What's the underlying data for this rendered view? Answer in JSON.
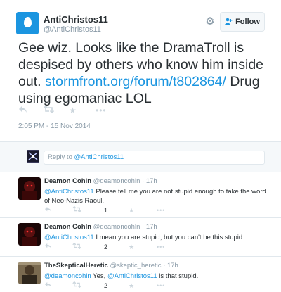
{
  "tweet": {
    "author_name": "AntiChristos11",
    "author_handle": "@AntiChristos11",
    "follow_label": "Follow",
    "text_before": "Gee wiz. Looks like the DramaTroll is despised by others who know him inside out. ",
    "link": "stormfront.org/forum/t802864/",
    "text_after": "  Drug using egomaniac LOL",
    "timestamp": "2:05 PM - 15 Nov 2014",
    "icons": [
      "reply-icon",
      "retweet-icon",
      "favorite-icon",
      "more-icon"
    ]
  },
  "reply_box": {
    "prefix": "Reply to ",
    "mention": "@AntiChristos11"
  },
  "replies": [
    {
      "name": "Deamon Cohln",
      "handle": "@deamoncohln",
      "separator": " · ",
      "time": "17h",
      "mention": "@AntiChristos11",
      "text": " Please tell me you are not stupid enough to take the word of Neo-Nazis Raoul.",
      "retweets": "1",
      "favorites": ""
    },
    {
      "name": "Deamon Cohln",
      "handle": "@deamoncohln",
      "separator": " · ",
      "time": "17h",
      "mention": "@AntiChristos11",
      "text": " I mean you are stupid, but you can't be this stupid.",
      "retweets": "2",
      "favorites": ""
    },
    {
      "name": "TheSkepticalHeretic",
      "handle": "@skeptic_heretic",
      "separator": " · ",
      "time": "17h",
      "mention": "@deamoncohln",
      "text_mid": " Yes, ",
      "mention2": "@AntiChristos11",
      "text": " is that stupid.",
      "retweets": "2",
      "favorites": ""
    }
  ],
  "colors": {
    "accent": "#1b95e0",
    "muted": "#8899a6",
    "text": "#292f33",
    "border": "#e1e8ed"
  }
}
